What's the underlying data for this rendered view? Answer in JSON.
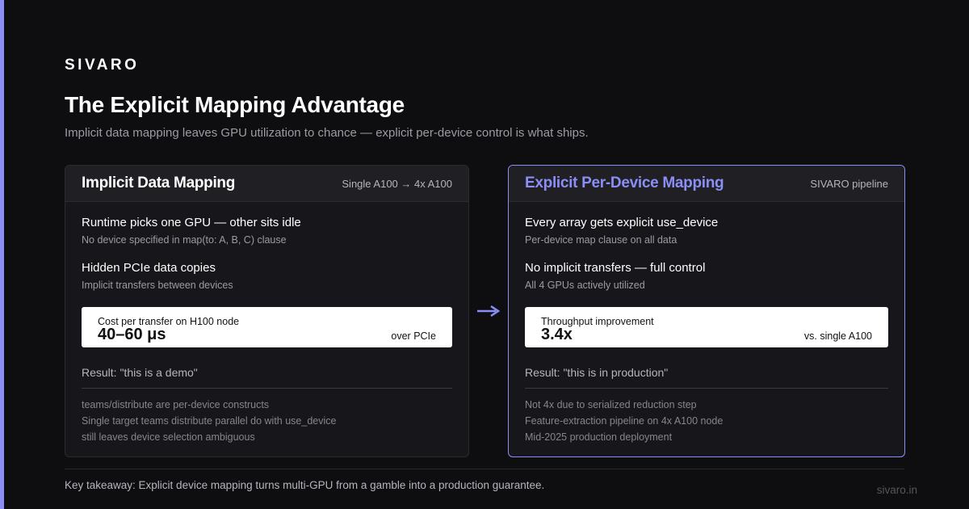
{
  "brand": "SIVARO",
  "title": "The Explicit Mapping Advantage",
  "subtitle": "Implicit data mapping leaves GPU utilization to chance — explicit per-device control is what ships.",
  "colors": {
    "accent": "#8b8ff5",
    "background": "#0e0e11",
    "card": "#17171b"
  },
  "left_card": {
    "title": "Implicit Data Mapping",
    "tag": "Single A100 → 4x A100",
    "points": [
      {
        "title": "Runtime picks one GPU — other sits idle",
        "desc": "No device specified in map(to: A, B, C) clause"
      },
      {
        "title": "Hidden PCIe data copies",
        "desc": "Implicit transfers between devices"
      }
    ],
    "metric": {
      "label": "Cost per transfer on H100 node",
      "value": "40–60 μs",
      "note": "over PCIe"
    },
    "result": "Result: \"this is a demo\"",
    "notes": [
      "teams/distribute are per-device constructs",
      "Single target teams distribute parallel do with use_device",
      "still leaves device selection ambiguous"
    ]
  },
  "right_card": {
    "title": "Explicit Per-Device Mapping",
    "tag": "SIVARO pipeline",
    "points": [
      {
        "title": "Every array gets explicit use_device",
        "desc": "Per-device map clause on all data"
      },
      {
        "title": "No implicit transfers — full control",
        "desc": "All 4 GPUs actively utilized"
      }
    ],
    "metric": {
      "label": "Throughput improvement",
      "value": "3.4x",
      "note": "vs. single A100"
    },
    "result": "Result: \"this is in production\"",
    "notes": [
      "Not 4x due to serialized reduction step",
      "Feature-extraction pipeline on 4x A100 node",
      "Mid-2025 production deployment"
    ]
  },
  "arrow_icon": "arrow-right-icon",
  "footer": "Key takeaway: Explicit device mapping turns multi-GPU from a gamble into a production guarantee.",
  "site": "sivaro.in"
}
